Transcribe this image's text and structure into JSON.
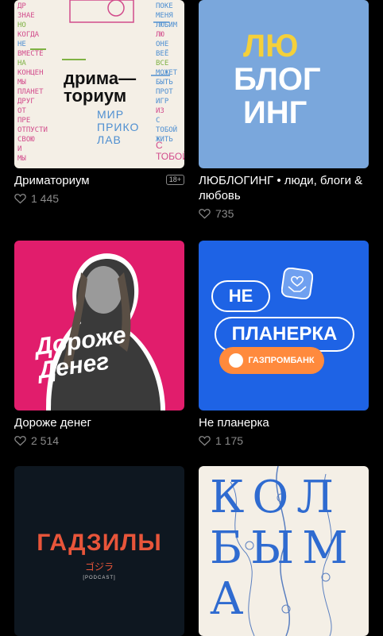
{
  "podcasts": [
    {
      "title": "Дриматориум",
      "age_badge": "18+",
      "likes": "1 445",
      "cover_text_main": "дрима—\nториум",
      "cover_text_sub": "МИР\nПРИКО\nЛАВ",
      "cover_text_tail": "С\nТОБОЙ"
    },
    {
      "title": "ЛЮБЛОГИНГ • люди, блоги & любовь",
      "likes": "735",
      "cover_text_1": "ЛЮ",
      "cover_text_2": "БЛОГ",
      "cover_text_3": "ИНГ"
    },
    {
      "title": "Дороже денег",
      "likes": "2 514",
      "cover_text": "Дороже\nДенег"
    },
    {
      "title": "Не планерка",
      "likes": "1 175",
      "cover_text_1": "НЕ",
      "cover_text_2": "ПЛАНЕРКА",
      "cover_text_3": "ГАЗПРОМБАНК"
    },
    {
      "title": "",
      "cover_text": "ГАДЗИЛЫ",
      "cover_sub": "ゴジラ",
      "cover_small": "[PODCAST]"
    },
    {
      "title": "",
      "cover_text": "КОЛБЫМА"
    }
  ]
}
